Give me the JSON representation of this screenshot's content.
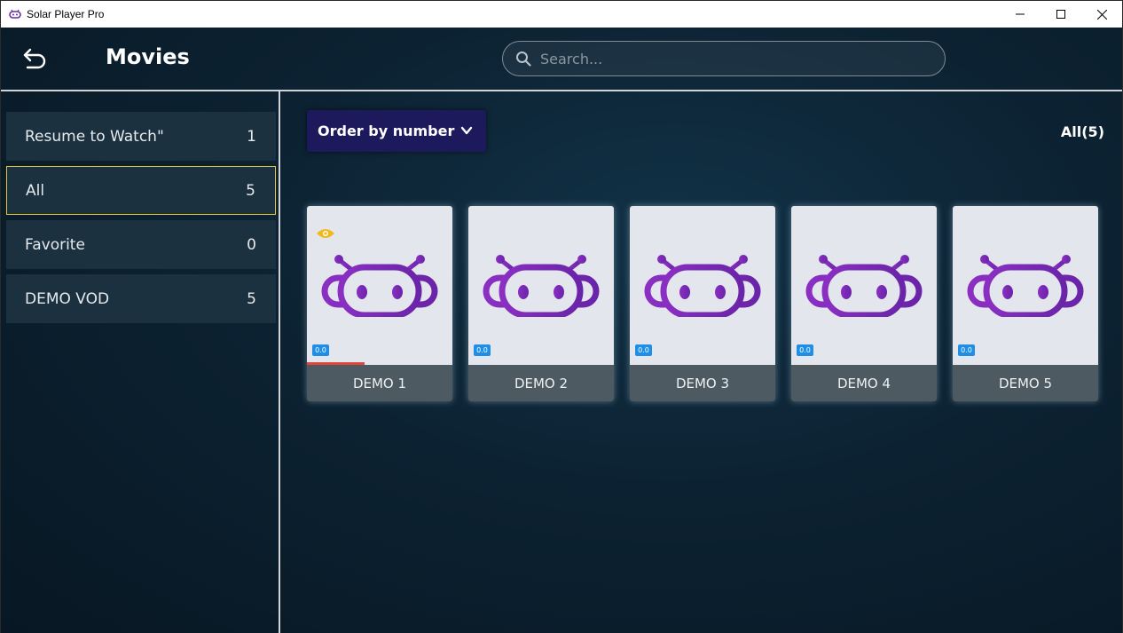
{
  "window": {
    "title": "Solar Player Pro"
  },
  "header": {
    "title": "Movies",
    "search_placeholder": "Search..."
  },
  "sidebar": {
    "items": [
      {
        "label": "Resume to Watch\"",
        "count": "1",
        "active": false
      },
      {
        "label": "All",
        "count": "5",
        "active": true
      },
      {
        "label": "Favorite",
        "count": "0",
        "active": false
      },
      {
        "label": "DEMO VOD",
        "count": "5",
        "active": false
      }
    ]
  },
  "toolbar": {
    "order_label": "Order by number",
    "all_count": "All(5)"
  },
  "movies": [
    {
      "title": "DEMO 1",
      "rating": "0.0",
      "watched": true,
      "progress": 0.4
    },
    {
      "title": "DEMO 2",
      "rating": "0.0",
      "watched": false,
      "progress": 0
    },
    {
      "title": "DEMO 3",
      "rating": "0.0",
      "watched": false,
      "progress": 0
    },
    {
      "title": "DEMO 4",
      "rating": "0.0",
      "watched": false,
      "progress": 0
    },
    {
      "title": "DEMO 5",
      "rating": "0.0",
      "watched": false,
      "progress": 0
    }
  ],
  "colors": {
    "accent_purple": "#1c1a5c",
    "active_border": "#e8c63a",
    "rating_blue": "#1e8ee6",
    "progress_red": "#e0453a",
    "watched_eye": "#f2b91d",
    "robot_purple": "#7b2ab8"
  },
  "icons": {
    "back": "back-arrow-icon",
    "search": "search-icon",
    "chevron": "chevron-down-icon",
    "watched": "eye-icon",
    "thumbnail": "robot-logo-icon"
  }
}
